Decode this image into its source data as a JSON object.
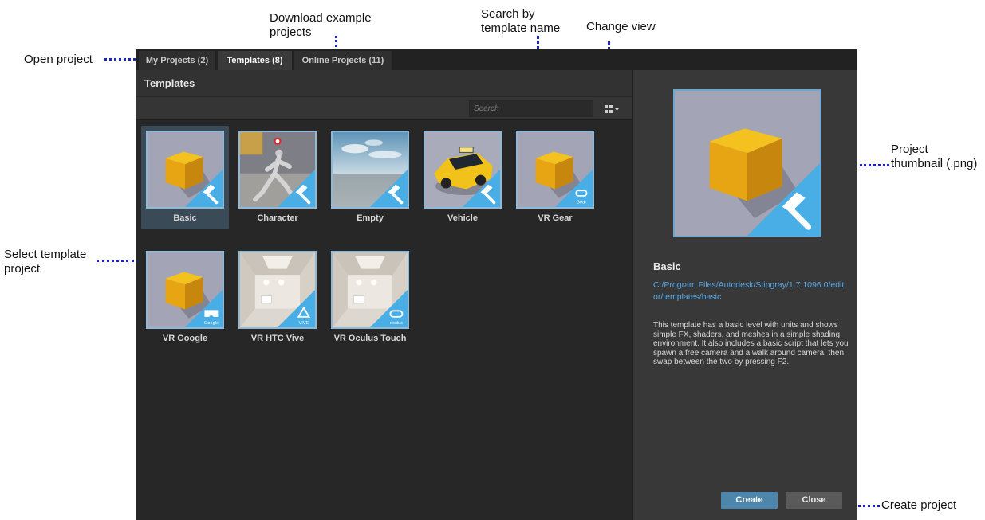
{
  "callouts": {
    "download": "Download example\nprojects",
    "search": "Search by\ntemplate name",
    "change_view": "Change view",
    "open_project": "Open project",
    "select_template": "Select template\nproject",
    "thumbnail": "Project\nthumbnail (.png)",
    "create_project": "Create project"
  },
  "tabs": [
    {
      "label": "My Projects (2)"
    },
    {
      "label": "Templates (8)",
      "active": true
    },
    {
      "label": "Online Projects (11)"
    }
  ],
  "panel": {
    "title": "Templates",
    "search_placeholder": "Search",
    "view_icon": "grid-view-icon"
  },
  "templates": [
    {
      "label": "Basic",
      "thumb": "cube",
      "badge": "hammer",
      "selected": true
    },
    {
      "label": "Character",
      "thumb": "character",
      "badge": "hammer"
    },
    {
      "label": "Empty",
      "thumb": "sky",
      "badge": "hammer"
    },
    {
      "label": "Vehicle",
      "thumb": "taxi",
      "badge": "hammer"
    },
    {
      "label": "VR Gear",
      "thumb": "cube",
      "badge": "gear",
      "badge_text": "Gear"
    },
    {
      "label": "VR Google",
      "thumb": "cube",
      "badge": "google",
      "badge_text": "Google"
    },
    {
      "label": "VR HTC Vive",
      "thumb": "room",
      "badge": "vive",
      "badge_text": "VIVE"
    },
    {
      "label": "VR Oculus Touch",
      "thumb": "room",
      "badge": "oculus",
      "badge_text": "oculus"
    }
  ],
  "detail": {
    "name": "Basic",
    "path": "C:/Program Files/Autodesk/Stingray/1.7.1096.0/editor/templates/basic",
    "description": "This template has a basic level with units and shows simple FX, shaders, and meshes in a simple shading environment. It also includes a basic script that lets you spawn a free camera and a walk around camera, then swap between the two by pressing F2.",
    "create_label": "Create",
    "close_label": "Close"
  },
  "colors": {
    "accent": "#4aaee6",
    "annotation": "#1a22c8",
    "cube": "#e7a513"
  }
}
